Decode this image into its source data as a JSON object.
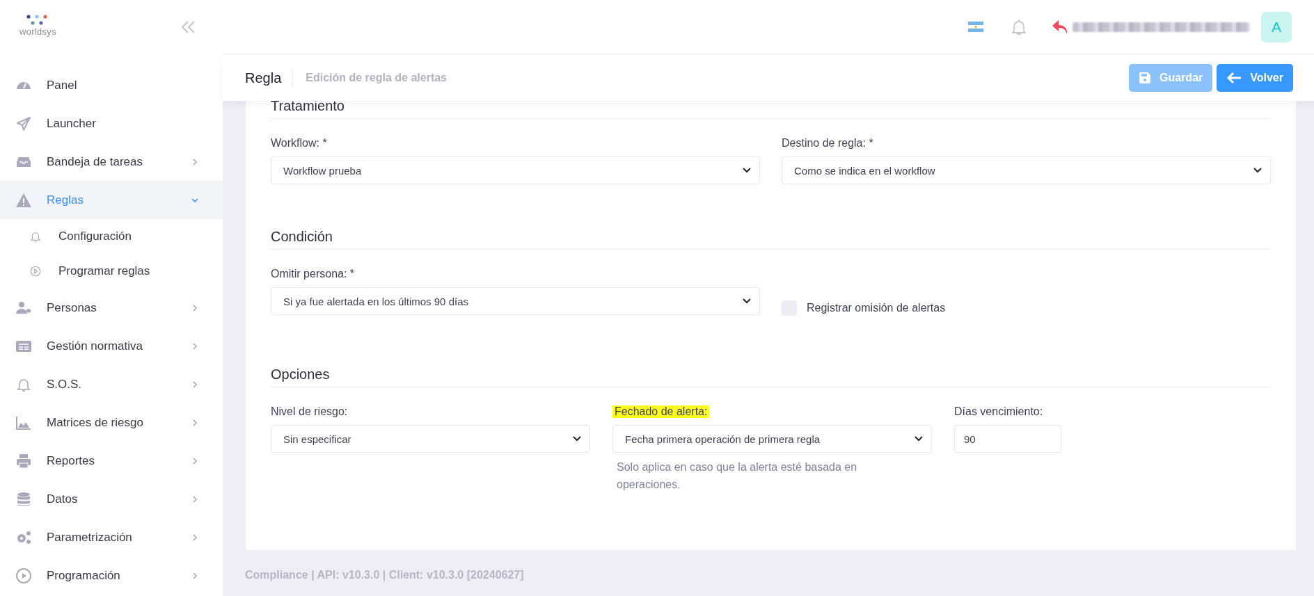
{
  "sidebar": {
    "logo": "worldsys",
    "items": [
      {
        "label": "Panel",
        "selected": false
      },
      {
        "label": "Launcher",
        "selected": false
      },
      {
        "label": "Bandeja de tareas",
        "selected": false,
        "expanded": false
      },
      {
        "label": "Reglas",
        "selected": true,
        "expanded": true,
        "children": [
          {
            "label": "Configuración",
            "selected": false
          },
          {
            "label": "Programar reglas",
            "selected": false
          }
        ]
      },
      {
        "label": "Personas",
        "selected": false,
        "expanded": false
      },
      {
        "label": "Gestión normativa",
        "selected": false,
        "expanded": false
      },
      {
        "label": "S.O.S.",
        "selected": false,
        "expanded": false
      },
      {
        "label": "Matrices de riesgo",
        "selected": false,
        "expanded": false
      },
      {
        "label": "Reportes",
        "selected": false,
        "expanded": false
      },
      {
        "label": "Datos",
        "selected": false,
        "expanded": false
      },
      {
        "label": "Parametrización",
        "selected": false,
        "expanded": false
      },
      {
        "label": "Programación",
        "selected": false,
        "expanded": false
      }
    ]
  },
  "topbar": {
    "avatar": "A"
  },
  "page_header": {
    "title": "Regla",
    "subtitle": "Edición de regla de alertas",
    "buttons": [
      {
        "label": "Guardar",
        "kind": "save",
        "disabled": true
      },
      {
        "label": "Volver",
        "kind": "back",
        "disabled": false
      }
    ]
  },
  "sections": [
    {
      "title": "Tratamiento",
      "fields": [
        {
          "kind": "select",
          "label": "Workflow: *",
          "value": "Workflow prueba"
        },
        {
          "kind": "select",
          "label": "Destino de regla: *",
          "value": "Como se indica en el workflow"
        }
      ]
    },
    {
      "title": "Condición",
      "fields": [
        {
          "kind": "select",
          "label": "Omitir persona: *",
          "value": "Si ya fue alertada en los últimos 90 días"
        },
        {
          "kind": "checkbox",
          "label": "Registrar omisión de alertas",
          "checked": false
        }
      ]
    },
    {
      "title": "Opciones",
      "fields": [
        {
          "kind": "select",
          "label": "Nivel de riesgo:",
          "value": "Sin especificar"
        },
        {
          "kind": "select",
          "label": "Fechado de alerta:",
          "highlighted": true,
          "value": "Fecha primera operación de primera regla",
          "hint": "Solo aplica en caso que la alerta esté basada en operaciones."
        },
        {
          "kind": "input",
          "label": "Días vencimiento:",
          "value": "90"
        }
      ]
    }
  ],
  "footer": "Compliance | API: v10.3.0 | Client: v10.3.0 [20240627]"
}
